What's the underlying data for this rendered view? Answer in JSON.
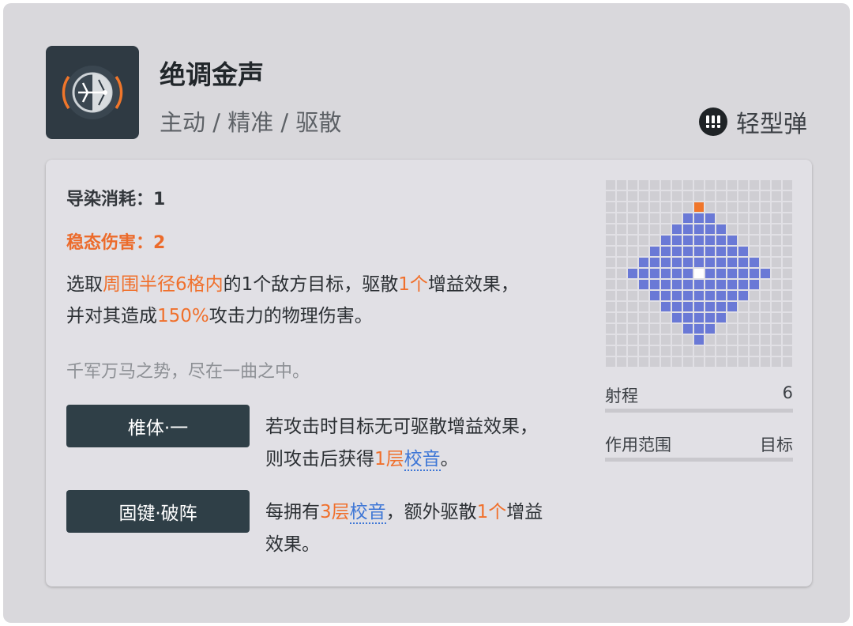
{
  "skill": {
    "name": "绝调金声",
    "tags": "主动 / 精准 / 驱散",
    "icon": "bow-icon"
  },
  "ammo": {
    "icon": "ammo-icon",
    "label": "轻型弹"
  },
  "card": {
    "cost_label": "导染消耗：1",
    "damage_label": "稳态伤害：2",
    "description": [
      {
        "text": "选取",
        "hl": ""
      },
      {
        "text": "周围半径6格内",
        "hl": "orange"
      },
      {
        "text": "的1个敌方目标，驱散",
        "hl": ""
      },
      {
        "text": "1个",
        "hl": "orange"
      },
      {
        "text": "增益效果，",
        "hl": ""
      },
      {
        "text": "",
        "hl": "br"
      },
      {
        "text": "并对其造成",
        "hl": ""
      },
      {
        "text": "150%",
        "hl": "orange"
      },
      {
        "text": "攻击力的物理伤害。",
        "hl": ""
      }
    ],
    "flavor": "千军万马之势，尽在一曲之中。",
    "modules": [
      {
        "name": "椎体·一",
        "text": [
          {
            "text": "若攻击时目标无可驱散增益效果，",
            "hl": ""
          },
          {
            "text": "",
            "hl": "br"
          },
          {
            "text": "则攻击后获得",
            "hl": ""
          },
          {
            "text": "1层",
            "hl": "orange"
          },
          {
            "text": "校音",
            "hl": "blue"
          },
          {
            "text": "。",
            "hl": ""
          }
        ]
      },
      {
        "name": "固键·破阵",
        "text": [
          {
            "text": "每拥有",
            "hl": ""
          },
          {
            "text": "3层",
            "hl": "orange"
          },
          {
            "text": "校音",
            "hl": "blue"
          },
          {
            "text": "，额外驱散",
            "hl": ""
          },
          {
            "text": "1个",
            "hl": "orange"
          },
          {
            "text": "增益",
            "hl": ""
          },
          {
            "text": "",
            "hl": "br"
          },
          {
            "text": "效果。",
            "hl": ""
          }
        ]
      }
    ]
  },
  "range_grid": {
    "size": 17,
    "radius": 6,
    "colors": {
      "empty": "#cfced3",
      "area": "#6a79d6",
      "center": "#ffffff",
      "marker": "#f0762b"
    }
  },
  "stats": [
    {
      "label": "射程",
      "value": "6"
    },
    {
      "label": "作用范围",
      "value": "目标"
    }
  ],
  "colors": {
    "accent_orange": "#f0702c",
    "link_blue": "#3d76d6",
    "button_bg": "#2f3f47"
  }
}
